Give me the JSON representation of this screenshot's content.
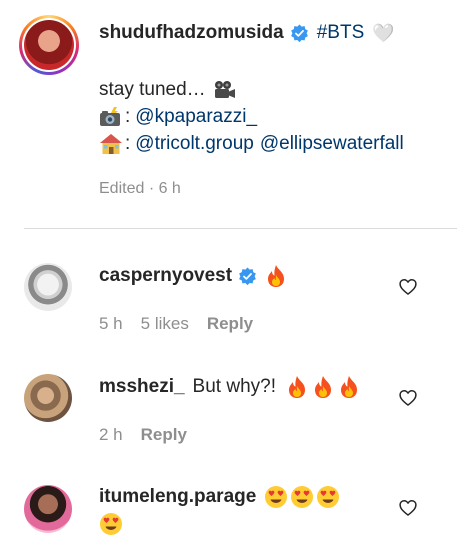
{
  "caption": {
    "username": "shudufhadzomusida",
    "hashtag": "#BTS",
    "heart_glyph": "🤍",
    "line1": "stay tuned…",
    "line2_prefix": ":",
    "line2_mention": "@kpaparazzi_",
    "line3_prefix": ":",
    "line3_mention_1": "@tricolt.group",
    "line3_mention_2": "@ellipsewaterfall",
    "meta": "Edited · 6 h",
    "icons": [
      "verified-badge-icon",
      "movie-camera-icon",
      "camera-flash-icon",
      "house-icon"
    ]
  },
  "comments": [
    {
      "username": "caspernyovest",
      "text": "",
      "emojis": [
        "fire"
      ],
      "time": "5 h",
      "likes": "5 likes",
      "reply": "Reply",
      "verified": true
    },
    {
      "username": "msshezi_",
      "text": "But why?!",
      "emojis": [
        "fire",
        "fire",
        "fire"
      ],
      "time": "2 h",
      "likes": "",
      "reply": "Reply",
      "verified": false
    },
    {
      "username": "itumeleng.parage",
      "text": "",
      "emojis": [
        "heart-eyes",
        "heart-eyes",
        "heart-eyes",
        "heart-eyes"
      ],
      "time": "",
      "likes": "",
      "reply": "",
      "verified": false
    }
  ],
  "colors": {
    "text": "#262626",
    "muted": "#8e8e8e",
    "mention": "#00376b",
    "verified": "#3897f0",
    "divider": "#dbdbdb"
  }
}
